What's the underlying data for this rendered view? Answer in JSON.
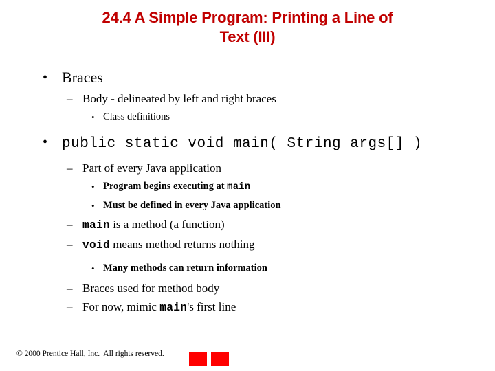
{
  "slide": {
    "title_line1": "24.4  A Simple Program: Printing a Line of",
    "title_line2": "Text (III)",
    "title_color": "#C00000",
    "background_color": "#FFFFFF",
    "text_color": "#000000"
  },
  "bullets": {
    "b1": {
      "marker": "•",
      "text": "Braces"
    },
    "b2": {
      "marker": "–",
      "text": "Body - delineated by left and right braces"
    },
    "b3": {
      "marker": "•",
      "text": "Class definitions"
    },
    "b4": {
      "marker": "•",
      "text": "public static void main( String args[] )"
    },
    "b5": {
      "marker": "–",
      "text": "Part of every Java application"
    },
    "b6": {
      "marker": "•",
      "text_before": "Program begins executing at ",
      "code": "main",
      "text_after": ""
    },
    "b7": {
      "marker": "•",
      "text": "Must be defined in every Java application"
    },
    "b8": {
      "marker": "–",
      "code": "main",
      "text_after": " is a method (a function)"
    },
    "b9": {
      "marker": "–",
      "code": "void",
      "text_after": " means method returns nothing"
    },
    "b10": {
      "marker": "•",
      "text": "Many methods can return information"
    },
    "b11": {
      "marker": "–",
      "text": "Braces used for method body"
    },
    "b12": {
      "marker": "–",
      "text_before": "For now, mimic ",
      "code": "main",
      "text_after": "'s first line"
    }
  },
  "footer": {
    "copyright": "© 2000 Prentice Hall, Inc.  All rights reserved.",
    "prev_label": "",
    "next_label": "",
    "button_color": "#FF0000",
    "arrow_color": "#C80000"
  }
}
